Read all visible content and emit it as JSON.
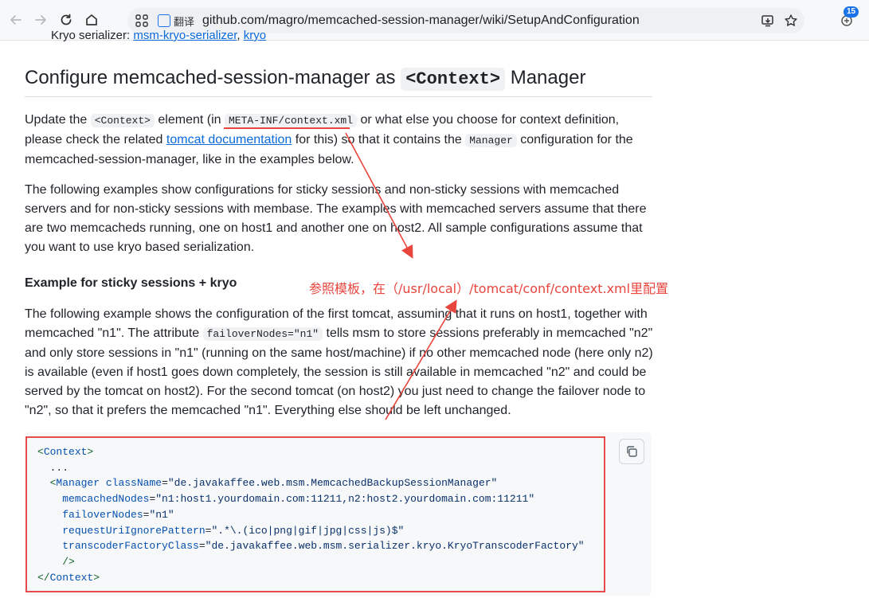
{
  "browser": {
    "url": "github.com/magro/memcached-session-manager/wiki/SetupAndConfiguration",
    "translate_label": "翻译",
    "badge_count": "15"
  },
  "prev": {
    "text": "Kryo serializer: ",
    "link1": "msm-kryo-serializer",
    "sep": ", ",
    "link2": "kryo"
  },
  "section": {
    "title_pre": "Configure memcached-session-manager as ",
    "title_code": "<Context>",
    "title_post": " Manager"
  },
  "para1": {
    "t1": "Update the ",
    "c1": "<Context>",
    "t2": " element (in ",
    "c2": "META-INF/context.xml",
    "t3": " or what else you choose for context definition, please check the related ",
    "link": "tomcat documentation",
    "t4": " for this) so that it contains the ",
    "c3": "Manager",
    "t5": " configuration for the memcached-session-manager, like in the examples below."
  },
  "para2": "The following examples show configurations for sticky sessions and non-sticky sessions with memcached servers and for non-sticky sessions with membase. The examples with memcached servers assume that there are two memcacheds running, one on host1 and another one on host2. All sample configurations assume that you want to use kryo based serialization.",
  "subheading": "Example for sticky sessions + kryo",
  "annotation": "参照模板，在（/usr/local）/tomcat/conf/context.xml里配置",
  "para3": {
    "t1": "The following example shows the configuration of the first tomcat, assuming that it runs on host1, together with memcached \"n1\". The attribute ",
    "c1": "failoverNodes=\"n1\"",
    "t2": " tells msm to store sessions preferably in memcached \"n2\" and only store sessions in \"n1\" (running on the same host/machine) if no other memcached node (here only n2) is available (even if host1 goes down completely, the session is still available in memcached \"n2\" and could be served by the tomcat on host2). For the second tomcat (on host2) you just need to change the failover node to \"n2\", so that it prefers the memcached \"n1\". Everything else should be left unchanged."
  },
  "code": {
    "open_tag": "Context",
    "ellipsis": "...",
    "manager_tag": "Manager",
    "attrs": [
      {
        "name": "className",
        "value": "\"de.javakaffee.web.msm.MemcachedBackupSessionManager\""
      },
      {
        "name": "memcachedNodes",
        "value": "\"n1:host1.yourdomain.com:11211,n2:host2.yourdomain.com:11211\""
      },
      {
        "name": "failoverNodes",
        "value": "\"n1\""
      },
      {
        "name": "requestUriIgnorePattern",
        "value": "\".*\\.(ico|png|gif|jpg|css|js)$\""
      },
      {
        "name": "transcoderFactoryClass",
        "value": "\"de.javakaffee.web.msm.serializer.kryo.KryoTranscoderFactory\""
      }
    ],
    "self_close": "/>",
    "close_tag": "Context"
  },
  "colors": {
    "link": "#0969da",
    "annotation": "#e8453c",
    "highlight_box": "#e84b4b"
  }
}
